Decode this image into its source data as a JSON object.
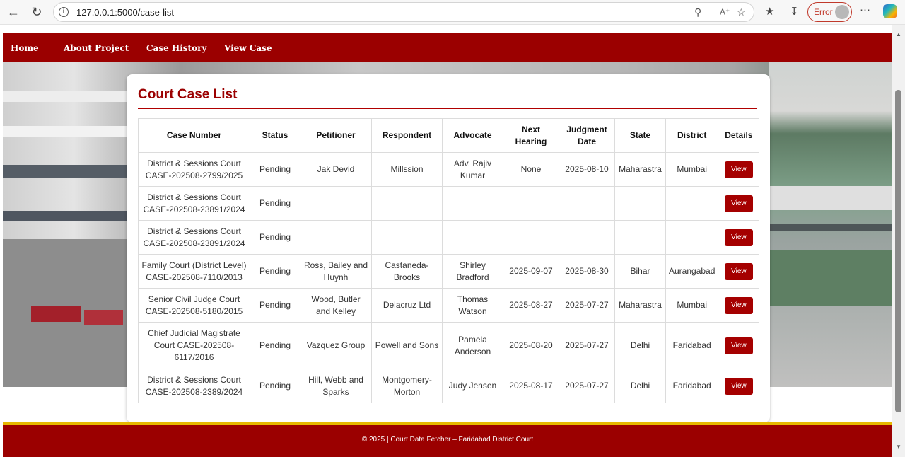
{
  "browser": {
    "url": "127.0.0.1:5000/case-list",
    "profile_status": "Error"
  },
  "nav": {
    "items": [
      "Home",
      "About Project",
      "Case History",
      "View Case"
    ]
  },
  "card": {
    "title": "Court Case List"
  },
  "table": {
    "headers": [
      "Case Number",
      "Status",
      "Petitioner",
      "Respondent",
      "Advocate",
      "Next Hearing",
      "Judgment Date",
      "State",
      "District",
      "Details"
    ],
    "rows": [
      {
        "case_number": "District & Sessions Court CASE-202508-2799/2025",
        "status": "Pending",
        "petitioner": "Jak Devid",
        "respondent": "Millssion",
        "advocate": "Adv. Rajiv Kumar",
        "next_hearing": "None",
        "judgment_date": "2025-08-10",
        "state": "Maharastra",
        "district": "Mumbai",
        "details": "View"
      },
      {
        "case_number": "District & Sessions Court CASE-202508-23891/2024",
        "status": "Pending",
        "petitioner": "",
        "respondent": "",
        "advocate": "",
        "next_hearing": "",
        "judgment_date": "",
        "state": "",
        "district": "",
        "details": "View"
      },
      {
        "case_number": "District & Sessions Court CASE-202508-23891/2024",
        "status": "Pending",
        "petitioner": "",
        "respondent": "",
        "advocate": "",
        "next_hearing": "",
        "judgment_date": "",
        "state": "",
        "district": "",
        "details": "View"
      },
      {
        "case_number": "Family Court (District Level) CASE-202508-7110/2013",
        "status": "Pending",
        "petitioner": "Ross, Bailey and Huynh",
        "respondent": "Castaneda-Brooks",
        "advocate": "Shirley Bradford",
        "next_hearing": "2025-09-07",
        "judgment_date": "2025-08-30",
        "state": "Bihar",
        "district": "Aurangabad",
        "details": "View"
      },
      {
        "case_number": "Senior Civil Judge Court CASE-202508-5180/2015",
        "status": "Pending",
        "petitioner": "Wood, Butler and Kelley",
        "respondent": "Delacruz Ltd",
        "advocate": "Thomas Watson",
        "next_hearing": "2025-08-27",
        "judgment_date": "2025-07-27",
        "state": "Maharastra",
        "district": "Mumbai",
        "details": "View"
      },
      {
        "case_number": "Chief Judicial Magistrate Court CASE-202508-6117/2016",
        "status": "Pending",
        "petitioner": "Vazquez Group",
        "respondent": "Powell and Sons",
        "advocate": "Pamela Anderson",
        "next_hearing": "2025-08-20",
        "judgment_date": "2025-07-27",
        "state": "Delhi",
        "district": "Faridabad",
        "details": "View"
      },
      {
        "case_number": "District & Sessions Court CASE-202508-2389/2024",
        "status": "Pending",
        "petitioner": "Hill, Webb and Sparks",
        "respondent": "Montgomery-Morton",
        "advocate": "Judy Jensen",
        "next_hearing": "2025-08-17",
        "judgment_date": "2025-07-27",
        "state": "Delhi",
        "district": "Faridabad",
        "details": "View"
      }
    ]
  },
  "footer": {
    "text": "© 2025 | Court Data Fetcher – Faridabad District Court"
  },
  "colors": {
    "brand": "#9b0000",
    "accent_band": "#e6b800"
  }
}
